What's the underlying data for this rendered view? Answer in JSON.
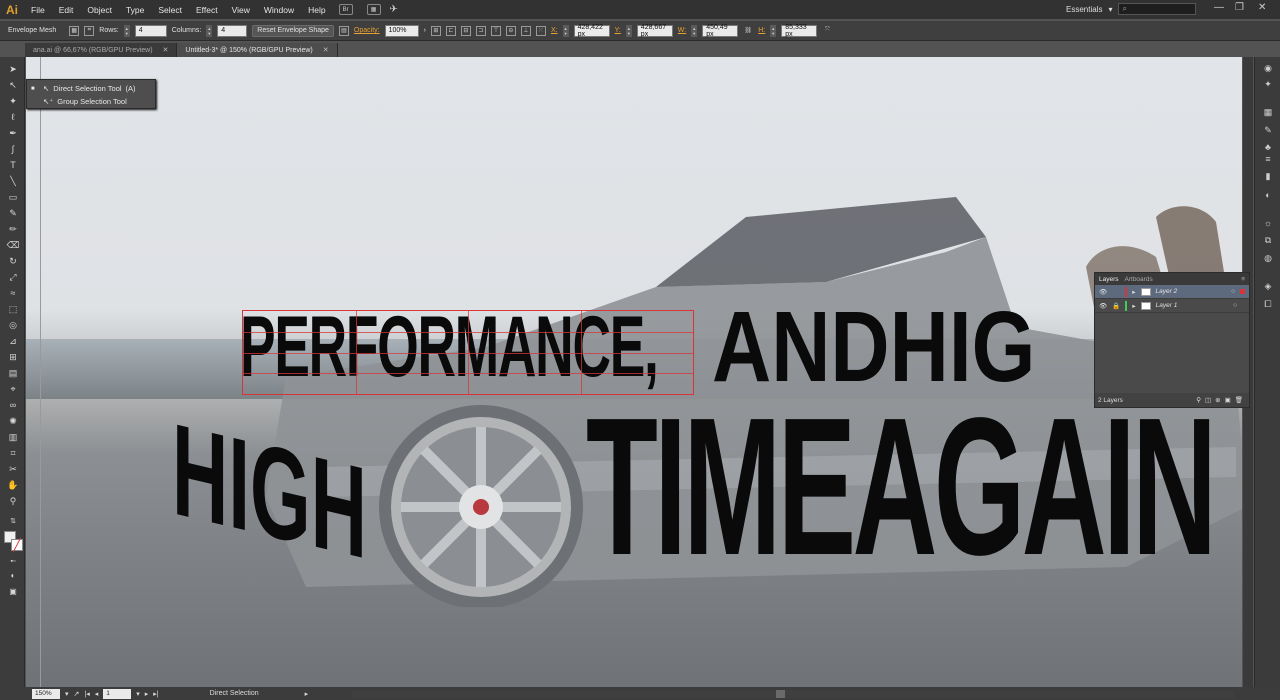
{
  "app": {
    "logo": "Ai"
  },
  "menu": [
    "File",
    "Edit",
    "Object",
    "Type",
    "Select",
    "Effect",
    "View",
    "Window",
    "Help"
  ],
  "menubar_icons": {
    "bridge": "Br"
  },
  "workspace": {
    "label": "Essentials"
  },
  "window_controls": [
    "—",
    "❐",
    "✕"
  ],
  "control_bar": {
    "tool_name": "Envelope Mesh",
    "rows_label": "Rows:",
    "rows_value": "4",
    "columns_label": "Columns:",
    "columns_value": "4",
    "reset_button": "Reset Envelope Shape",
    "opacity_label": "Opacity:",
    "opacity_value": "100%",
    "x_label": "X:",
    "x_value": "428,422 px",
    "y_label": "Y:",
    "y_value": "428,667 px",
    "w_label": "W:",
    "w_value": "450,49 px",
    "h_label": "H:",
    "h_value": "85,333 px"
  },
  "tabs": [
    {
      "label": "ana.ai @ 66,67% (RGB/GPU Preview)",
      "active": false
    },
    {
      "label": "Untitled-3* @ 150% (RGB/GPU Preview)",
      "active": true
    }
  ],
  "flyout": {
    "items": [
      {
        "label": "Direct Selection Tool",
        "shortcut": "(A)"
      },
      {
        "label": "Group Selection Tool",
        "shortcut": ""
      }
    ]
  },
  "artwork": {
    "line1": "PERFORMANCE,",
    "line2": "ANDHIG",
    "line3": "TIMEAGAIN",
    "line4": "HIGH"
  },
  "layers_panel": {
    "tabs": [
      "Layers",
      "Artboards"
    ],
    "layers": [
      {
        "name": "Layer 2",
        "color": "#d7353a",
        "selected": true
      },
      {
        "name": "Layer 1",
        "color": "#3ecb5a",
        "selected": false
      }
    ],
    "count": "2 Layers"
  },
  "status_bar": {
    "zoom": "150%",
    "page": "1",
    "tool": "Direct Selection"
  },
  "colors": {
    "accent_orange": "#e8a033",
    "mesh_red": "#d7353a"
  }
}
